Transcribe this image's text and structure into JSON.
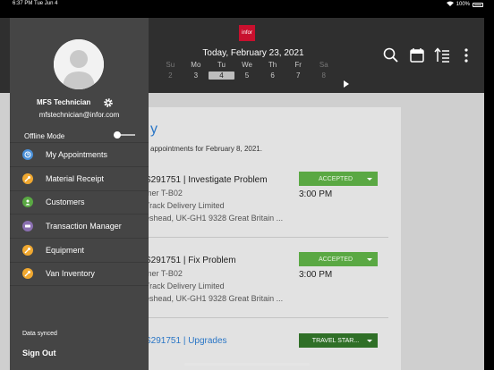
{
  "status_bar": {
    "time": "6:37 PM",
    "date": "Tue Jun 4",
    "battery": "100%"
  },
  "header": {
    "logo": "infor",
    "date": "Today, February 23, 2021",
    "week": [
      {
        "day": "Su",
        "num": "2"
      },
      {
        "day": "Mo",
        "num": "3"
      },
      {
        "day": "Tu",
        "num": "4"
      },
      {
        "day": "We",
        "num": "5"
      },
      {
        "day": "Th",
        "num": "6"
      },
      {
        "day": "Fr",
        "num": "7"
      },
      {
        "day": "Sa",
        "num": "8"
      }
    ],
    "icons": [
      "search-icon",
      "calendar-icon",
      "sort-icon",
      "more-icon"
    ]
  },
  "main": {
    "title": "y",
    "subtitle": "appointments for February 8, 2021.",
    "appointments": [
      {
        "id": "S291751 | Investigate Problem",
        "customer": "mer T-B02",
        "company": "Track Delivery Limited",
        "address": "eshead, UK-GH1 9328 Great Britain ...",
        "status": "ACCEPTED",
        "time": "3:00 PM"
      },
      {
        "id": "S291751 | Fix Problem",
        "customer": "mer T-B02",
        "company": "Track Delivery Limited",
        "address": "eshead, UK-GH1 9328 Great Britain ...",
        "status": "ACCEPTED",
        "time": "3:00 PM"
      },
      {
        "id": "S291751 | Upgrades",
        "status": "TRAVEL STAR..."
      }
    ]
  },
  "drawer": {
    "user_name": "MFS Technician",
    "email": "mfstechnician@infor.com",
    "offline_label": "Offline Mode",
    "offline_enabled": false,
    "items": [
      {
        "label": "My Appointments",
        "icon": "clock-icon",
        "color": "#4a90d9"
      },
      {
        "label": "Material Receipt",
        "icon": "wrench-icon",
        "color": "#f0a830"
      },
      {
        "label": "Customers",
        "icon": "people-icon",
        "color": "#5aa843"
      },
      {
        "label": "Transaction Manager",
        "icon": "transaction-icon",
        "color": "#8a6fb0"
      },
      {
        "label": "Equipment",
        "icon": "wrench-icon",
        "color": "#f0a830"
      },
      {
        "label": "Van Inventory",
        "icon": "wrench-icon",
        "color": "#f0a830"
      }
    ],
    "sync_status": "Data synced",
    "sign_out": "Sign Out"
  }
}
